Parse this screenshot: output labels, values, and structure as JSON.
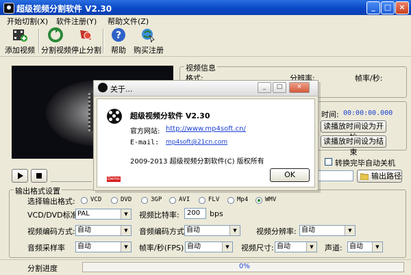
{
  "window": {
    "title": "超级视频分割软件 V2.30",
    "controls": [
      "_",
      "□",
      "×"
    ]
  },
  "menu": [
    "开始切割(X)",
    "软件注册(Y)",
    "帮助文件(Z)"
  ],
  "toolbar": [
    {
      "label": "添加视频",
      "icon": "film-add-icon"
    },
    {
      "label": "分割视频",
      "icon": "recycle-split-icon"
    },
    {
      "label": "停止分割",
      "icon": "stop-icon"
    },
    {
      "label": "帮助",
      "icon": "help-icon"
    },
    {
      "label": "购买注册",
      "icon": "register-icon"
    }
  ],
  "video_info": {
    "legend": "视频信息",
    "format_label": "格式:",
    "resolution_label": "分辨率:",
    "framerate_label": "帧率/秒:"
  },
  "playback": {
    "time_label_suffix": "时间:",
    "time_value": "00:00:00.000",
    "set_start_button": "读播放时间设为开始",
    "set_end_button": "读播放时间设为结束",
    "shutdown_checkbox": "转换完毕自动关机",
    "output_path_button": "输出路径"
  },
  "output": {
    "legend": "输出格式设置",
    "format_label": "选择输出格式:",
    "formats": [
      "VCD",
      "DVD",
      "3GP",
      "AVI",
      "FLV",
      "Mp4",
      "WMV"
    ],
    "selected_format": "WMV",
    "standard_label": "VCD/DVD标准:",
    "standard_value": "PAL",
    "bitrate_label": "视频比特率:",
    "bitrate_value": "200",
    "bitrate_unit": "bps",
    "video_codec_label": "视频编码方式:",
    "video_codec_value": "自动",
    "audio_codec_label": "音频编码方式:",
    "audio_codec_value": "自动",
    "resolution_label": "视频分辨率:",
    "resolution_value": "自动",
    "sample_rate_label": "音频采样率",
    "sample_rate_value": "自动",
    "fps_label": "帧率/秒(FPS)",
    "fps_value": "自动",
    "video_size_label": "视频尺寸:",
    "video_size_value": "自动",
    "channel_label": "声道:",
    "channel_value": "自动"
  },
  "status": {
    "progress_label": "分割进度",
    "progress_value": "0%",
    "progress_fraction": 0
  },
  "about": {
    "title": "关于...",
    "app_name": "超级视频分软件 V2.30",
    "website_label": "官方网站:",
    "website": "http://www.mp4soft.cn/",
    "email_label": "E-mail:",
    "email": "mp4soft@21cn.com",
    "copyright": "2009-2013 超级视频分割软件(C) 版权所有",
    "ok_button": "OK",
    "red_tag": "Demo"
  },
  "colors": {
    "titlebar": "#0a48c6",
    "time_value": "#1a3fd0",
    "link": "#1a3fd0",
    "progress_text": "#1a3fd0"
  }
}
